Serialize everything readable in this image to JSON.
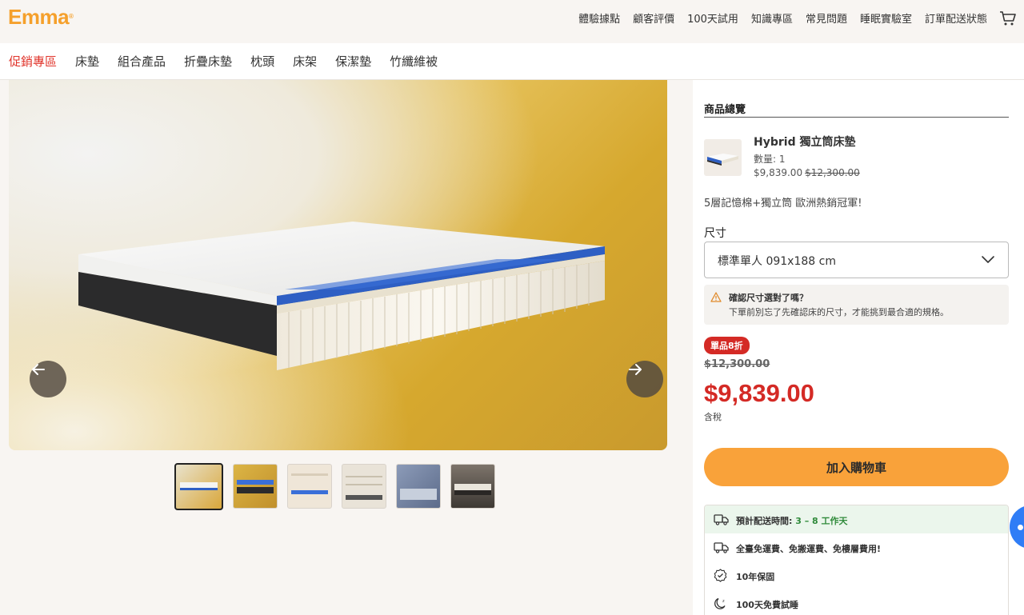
{
  "brand": {
    "logo": "Emma",
    "logo_mark": "®",
    "accent": "#f5a02c"
  },
  "top_nav": [
    "體驗據點",
    "顧客評價",
    "100天試用",
    "知識專區",
    "常見問題",
    "睡眠實驗室",
    "訂單配送狀態"
  ],
  "cart_icon": "cart-icon",
  "category_nav": {
    "items": [
      "促銷專區",
      "床墊",
      "組合產品",
      "折疊床墊",
      "枕頭",
      "床架",
      "保潔墊",
      "竹纖維被"
    ],
    "active_index": 0,
    "active_color": "#e0342b"
  },
  "gallery": {
    "prev_icon": "arrow-left-icon",
    "next_icon": "arrow-right-icon",
    "thumbnail_count": 6,
    "active_thumbnail": 0
  },
  "summary": {
    "title": "商品總覽",
    "product_name": "Hybrid 獨立筒床墊",
    "quantity_label": "數量: 1",
    "price": "$9,839.00",
    "original_price": "$12,300.00",
    "tagline": "5層記憶棉+獨立筒 歐洲熱銷冠軍!"
  },
  "size": {
    "label": "尺寸",
    "selected": "標準單人 091x188 cm"
  },
  "size_notice": {
    "title": "確認尺寸選對了嗎？",
    "body": "下單前別忘了先確認床的尺寸，才能挑到最合適的規格。"
  },
  "pricing": {
    "badge": "單品8折",
    "old_price": "$12,300.00",
    "new_price": "$9,839.00",
    "tax_note": "含稅",
    "sale_color": "#d42a25"
  },
  "add_to_cart": {
    "label": "加入購物車",
    "color": "#f9a23a"
  },
  "info": {
    "delivery_prefix": "預計配送時間: ",
    "delivery_days": "3 – 8 工作天",
    "shipping": "全臺免運費、免搬運費、免樓層費用!",
    "warranty": "10年保固",
    "trial": "100天免費試睡"
  }
}
